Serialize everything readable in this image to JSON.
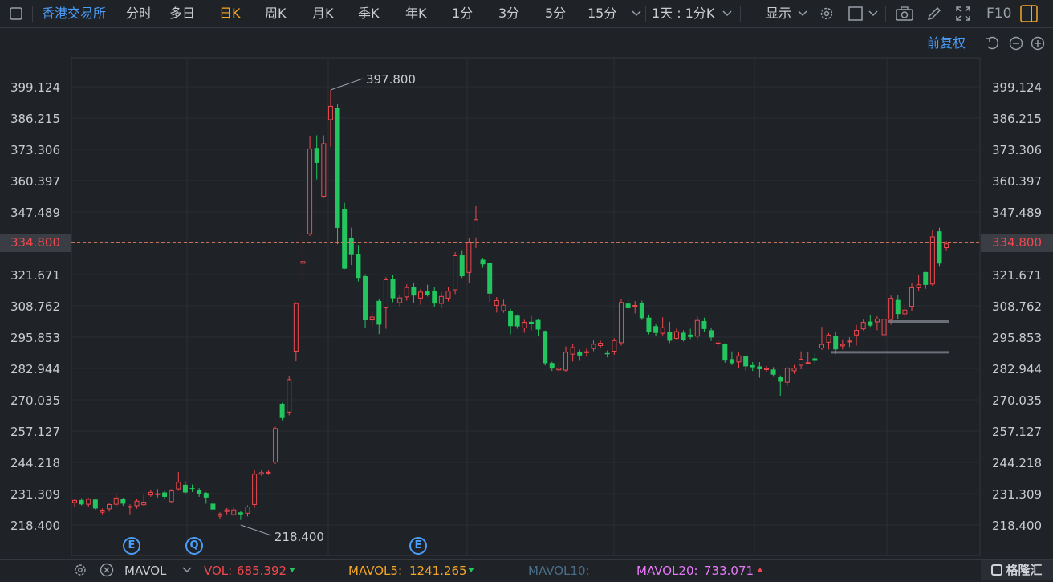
{
  "toolbar": {
    "exchange": "香港交易所",
    "tabs": [
      "分时",
      "多日",
      "日K",
      "周K",
      "月K",
      "季K",
      "年K",
      "1分",
      "3分",
      "5分",
      "15分"
    ],
    "active_tab": "日K",
    "interval_select": "1天 : 1分K",
    "display_label": "显示",
    "f10_label": "F10"
  },
  "subbar": {
    "adjust_label": "前复权"
  },
  "axis": {
    "ticks": [
      "399.124",
      "386.215",
      "373.306",
      "360.397",
      "347.489",
      "334.800",
      "321.671",
      "308.762",
      "295.853",
      "282.944",
      "270.035",
      "257.127",
      "244.218",
      "231.309",
      "218.400"
    ],
    "current_price": "334.800",
    "max_label": "397.800",
    "min_label": "218.400"
  },
  "events": [
    "E",
    "Q",
    "E"
  ],
  "footer": {
    "indicator": "MAVOL",
    "vol_label": "VOL:",
    "vol_value": "685.392",
    "mavol5_label": "MAVOL5:",
    "mavol5_value": "1241.265",
    "mavol10_label": "MAVOL10:",
    "mavol20_label": "MAVOL20:",
    "mavol20_value": "733.071",
    "brand": "格隆汇"
  },
  "colors": {
    "up": "#f0484e",
    "down": "#22c55e",
    "accent": "#4a9df8",
    "active": "#f5a623",
    "mavol20": "#e879f9",
    "mavol5": "#f5a623",
    "mavol10": "#4a6e8a"
  },
  "chart_data": {
    "type": "candlestick",
    "ylim": [
      218.4,
      399.124
    ],
    "current_price": 334.8,
    "max_price": 397.8,
    "min_price": 218.4,
    "candles": [
      [
        227.5,
        228.7,
        229.2,
        226.0
      ],
      [
        228.7,
        226.9,
        229.5,
        226.5
      ],
      [
        226.8,
        229.2,
        229.6,
        225.7
      ],
      [
        228.9,
        225.2,
        229.2,
        224.8
      ],
      [
        223.5,
        224.7,
        225.2,
        222.8
      ],
      [
        224.9,
        227.0,
        227.6,
        223.9
      ],
      [
        226.8,
        229.7,
        231.3,
        225.7
      ],
      [
        229.2,
        227.2,
        229.6,
        226.3
      ],
      [
        225.8,
        226.2,
        226.9,
        222.8
      ],
      [
        226.2,
        228.4,
        229.1,
        225.1
      ],
      [
        226.6,
        228.0,
        230.8,
        226.3
      ],
      [
        230.6,
        232.0,
        233.0,
        230.0
      ],
      [
        230.9,
        231.4,
        233.2,
        229.7
      ],
      [
        231.8,
        230.0,
        232.4,
        229.4
      ],
      [
        227.9,
        232.6,
        233.2,
        227.5
      ],
      [
        233.1,
        236.2,
        240.3,
        232.5
      ],
      [
        235.0,
        231.8,
        236.5,
        231.3
      ],
      [
        233.6,
        233.5,
        235.1,
        232.0
      ],
      [
        232.9,
        231.3,
        233.6,
        230.0
      ],
      [
        231.6,
        229.7,
        232.0,
        227.2
      ],
      [
        227.2,
        224.8,
        228.2,
        224.5
      ],
      [
        221.9,
        223.1,
        223.6,
        221.0
      ],
      [
        223.8,
        224.8,
        225.4,
        222.8
      ],
      [
        222.5,
        224.8,
        225.7,
        222.1
      ],
      [
        223.6,
        222.8,
        224.2,
        220.5
      ],
      [
        223.1,
        226.0,
        226.5,
        221.9
      ],
      [
        226.7,
        239.5,
        240.9,
        225.5
      ],
      [
        239.2,
        240.1,
        241.0,
        238.7
      ],
      [
        240.3,
        240.3,
        241.0,
        239.0
      ],
      [
        244.2,
        258.3,
        258.9,
        243.6
      ],
      [
        268.4,
        262.5,
        268.8,
        261.6
      ],
      [
        264.8,
        278.5,
        279.8,
        263.6
      ],
      [
        289.9,
        309.9,
        310.3,
        285.9
      ],
      [
        326.2,
        327.2,
        338.4,
        318.1
      ],
      [
        338.3,
        373.6,
        378.6,
        337.6
      ],
      [
        373.9,
        367.7,
        379.1,
        360.9
      ],
      [
        353.8,
        375.8,
        379.1,
        353.2
      ],
      [
        385.4,
        391.2,
        397.8,
        374.4
      ],
      [
        390.3,
        340.9,
        391.8,
        334.2
      ],
      [
        348.8,
        324.1,
        351.3,
        323.9
      ],
      [
        336.9,
        329.7,
        341.0,
        325.6
      ],
      [
        330.0,
        320.3,
        333.8,
        318.8
      ],
      [
        321.0,
        302.8,
        321.8,
        299.8
      ],
      [
        302.8,
        304.3,
        306.4,
        300.2
      ],
      [
        310.8,
        301.0,
        311.8,
        297.1
      ],
      [
        307.8,
        319.7,
        320.6,
        299.3
      ],
      [
        319.7,
        311.9,
        321.4,
        310.3
      ],
      [
        309.9,
        312.2,
        313.3,
        308.5
      ],
      [
        312.3,
        316.5,
        317.6,
        310.9
      ],
      [
        316.5,
        313.0,
        318.1,
        310.1
      ],
      [
        311.8,
        314.6,
        315.8,
        309.2
      ],
      [
        314.7,
        313.2,
        317.5,
        312.6
      ],
      [
        314.8,
        309.7,
        316.5,
        308.4
      ],
      [
        309.6,
        312.8,
        314.5,
        307.6
      ],
      [
        311.8,
        315.0,
        316.7,
        310.6
      ],
      [
        315.2,
        329.6,
        330.9,
        313.6
      ],
      [
        329.6,
        321.0,
        331.4,
        320.3
      ],
      [
        322.4,
        334.9,
        336.6,
        318.2
      ],
      [
        336.6,
        344.4,
        350.0,
        332.6
      ],
      [
        327.8,
        325.9,
        328.4,
        324.5
      ],
      [
        326.4,
        313.8,
        326.7,
        310.5
      ],
      [
        308.8,
        311.1,
        312.4,
        306.0
      ],
      [
        306.6,
        309.2,
        311.3,
        305.9
      ],
      [
        306.5,
        300.4,
        307.5,
        297.0
      ],
      [
        304.7,
        300.3,
        305.2,
        299.3
      ],
      [
        299.5,
        302.1,
        303.0,
        297.7
      ],
      [
        302.2,
        301.2,
        304.6,
        298.7
      ],
      [
        302.9,
        299.0,
        303.5,
        296.4
      ],
      [
        298.4,
        285.1,
        298.6,
        284.2
      ],
      [
        285.2,
        282.9,
        285.7,
        281.9
      ],
      [
        282.2,
        283.2,
        285.6,
        280.9
      ],
      [
        282.1,
        289.8,
        292.0,
        281.5
      ],
      [
        288.7,
        291.7,
        293.2,
        285.8
      ],
      [
        289.6,
        288.3,
        290.7,
        286.1
      ],
      [
        289.3,
        290.0,
        291.1,
        287.8
      ],
      [
        291.0,
        293.1,
        294.5,
        290.1
      ],
      [
        292.2,
        293.5,
        294.4,
        291.4
      ],
      [
        289.3,
        288.8,
        290.4,
        287.5
      ],
      [
        289.9,
        294.6,
        295.4,
        288.6
      ],
      [
        293.4,
        310.3,
        311.6,
        292.4
      ],
      [
        309.7,
        307.8,
        312.0,
        306.4
      ],
      [
        308.4,
        309.1,
        310.7,
        305.6
      ],
      [
        309.8,
        303.7,
        310.9,
        302.9
      ],
      [
        303.9,
        298.0,
        305.2,
        297.0
      ],
      [
        300.4,
        297.6,
        301.5,
        296.3
      ],
      [
        297.3,
        299.9,
        304.0,
        296.6
      ],
      [
        298.0,
        294.4,
        302.2,
        293.4
      ],
      [
        295.2,
        298.3,
        299.4,
        294.6
      ],
      [
        297.7,
        294.6,
        298.7,
        294.1
      ],
      [
        296.9,
        295.9,
        299.3,
        295.1
      ],
      [
        296.1,
        302.9,
        304.5,
        295.1
      ],
      [
        302.5,
        299.2,
        303.9,
        298.1
      ],
      [
        298.7,
        295.7,
        299.7,
        294.3
      ],
      [
        293.6,
        293.6,
        295.0,
        291.7
      ],
      [
        293.0,
        286.2,
        293.3,
        285.3
      ],
      [
        286.8,
        285.1,
        290.0,
        284.3
      ],
      [
        285.5,
        288.3,
        289.5,
        283.1
      ],
      [
        287.9,
        283.8,
        288.3,
        282.1
      ],
      [
        284.3,
        283.4,
        285.6,
        281.9
      ],
      [
        283.8,
        282.6,
        285.6,
        279.1
      ],
      [
        282.3,
        283.0,
        284.0,
        281.5
      ],
      [
        282.5,
        280.4,
        283.5,
        279.5
      ],
      [
        279.3,
        277.5,
        280.1,
        271.7
      ],
      [
        277.1,
        283.2,
        283.6,
        275.7
      ],
      [
        281.8,
        283.2,
        284.4,
        280.7
      ],
      [
        284.1,
        286.9,
        290.0,
        282.6
      ],
      [
        284.9,
        285.5,
        289.6,
        284.9
      ],
      [
        287.1,
        286.1,
        289.1,
        284.5
      ],
      [
        291.2,
        293.0,
        300.1,
        290.6
      ],
      [
        293.6,
        296.9,
        297.6,
        290.8
      ],
      [
        296.5,
        290.8,
        298.2,
        288.9
      ],
      [
        292.1,
        293.0,
        294.9,
        290.8
      ],
      [
        294.4,
        294.4,
        295.8,
        291.8
      ],
      [
        296.6,
        298.8,
        300.9,
        292.4
      ],
      [
        299.1,
        302.1,
        303.1,
        298.6
      ],
      [
        302.3,
        300.6,
        305.0,
        300.1
      ],
      [
        302.0,
        303.5,
        304.4,
        298.7
      ],
      [
        296.7,
        303.4,
        303.9,
        292.6
      ],
      [
        303.0,
        312.0,
        313.0,
        301.0
      ],
      [
        311.2,
        305.4,
        313.4,
        303.4
      ],
      [
        305.3,
        307.2,
        309.5,
        303.9
      ],
      [
        308.4,
        316.4,
        318.0,
        306.5
      ],
      [
        316.1,
        317.6,
        321.4,
        314.7
      ],
      [
        322.7,
        317.4,
        322.8,
        315.8
      ],
      [
        317.6,
        337.4,
        340.0,
        317.0
      ],
      [
        339.5,
        326.2,
        341.0,
        325.2
      ],
      [
        332.6,
        334.5,
        335.5,
        331.4
      ]
    ]
  }
}
